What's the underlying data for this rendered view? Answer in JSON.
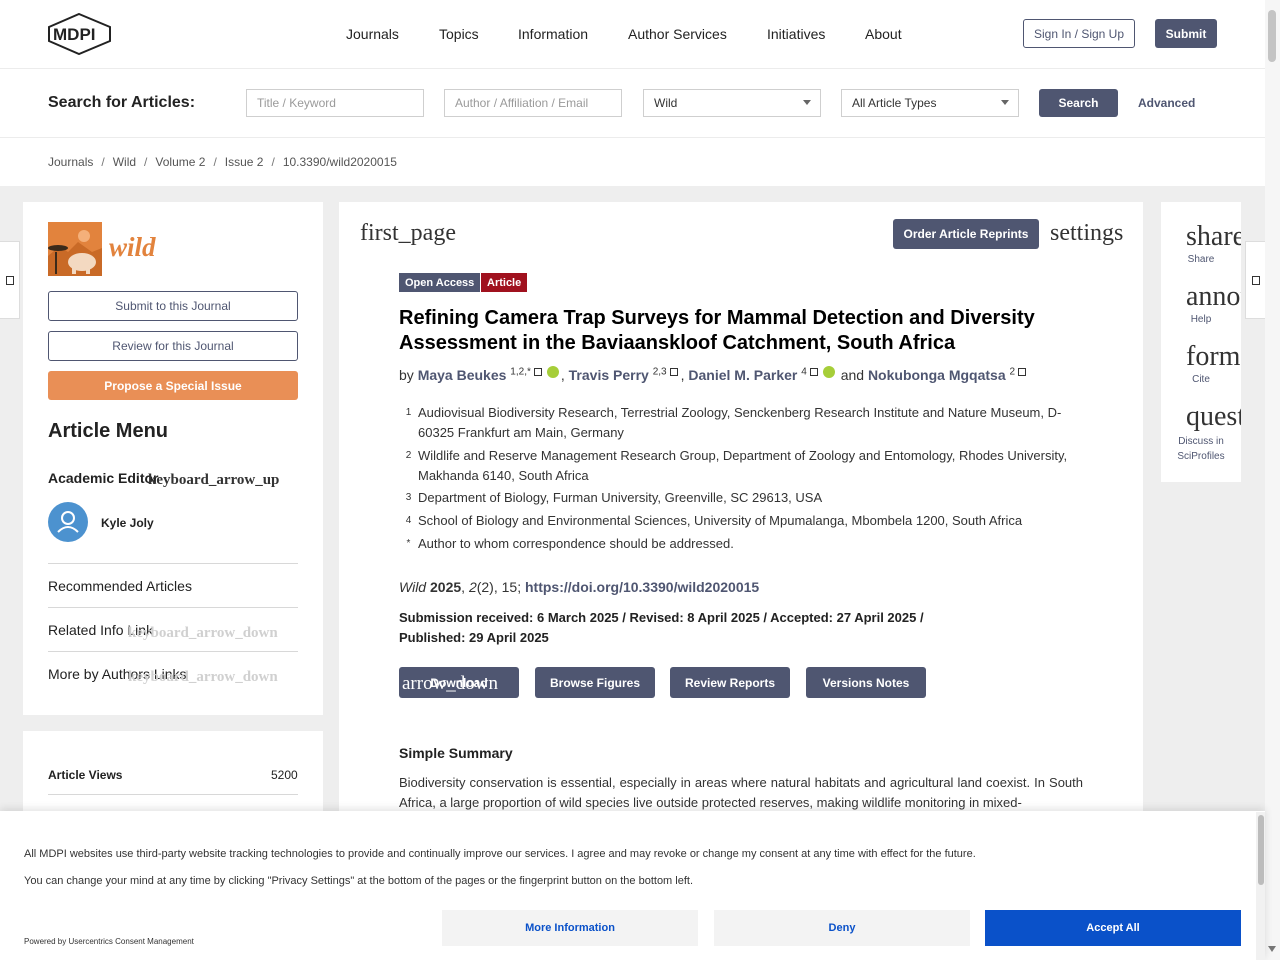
{
  "header": {
    "logo_text": "MDPI",
    "nav": [
      "Journals",
      "Topics",
      "Information",
      "Author Services",
      "Initiatives",
      "About"
    ],
    "signin": "Sign In / Sign Up",
    "submit": "Submit"
  },
  "search": {
    "label": "Search for Articles:",
    "title_placeholder": "Title / Keyword",
    "author_placeholder": "Author / Affiliation / Email",
    "journal": "Wild",
    "type": "All Article Types",
    "button": "Search",
    "advanced": "Advanced"
  },
  "breadcrumb": [
    "Journals",
    "Wild",
    "Volume 2",
    "Issue 2",
    "10.3390/wild2020015"
  ],
  "sidebar": {
    "journal_name": "wild",
    "submit": "Submit to this Journal",
    "review": "Review for this Journal",
    "propose": "Propose a Special Issue",
    "menu_title": "Article Menu",
    "academic_editor": "Academic Editor",
    "arrow_up": "keyboard_arrow_up",
    "editor_name": "Kyle Joly",
    "links": [
      "Recommended Articles",
      "Related Info Link",
      "More by Authors Links"
    ],
    "arrow_down": "keyboard_arrow_down",
    "views_label": "Article Views",
    "views_value": "5200"
  },
  "article": {
    "first_page": "first_page",
    "order_reprints": "Order Article Reprints",
    "settings": "settings",
    "tag_open": "Open Access",
    "tag_type": "Article",
    "title": "Refining Camera Trap Surveys for Mammal Detection and Diversity Assessment in the Baviaanskloof Catchment, South Africa",
    "by": "by",
    "authors": [
      {
        "name": "Maya Beukes",
        "sup": "1,2,*"
      },
      {
        "name": "Travis Perry",
        "sup": "2,3"
      },
      {
        "name": "Daniel M. Parker",
        "sup": "4"
      },
      {
        "name": "Nokubonga Mgqatsa",
        "sup": "2"
      }
    ],
    "and": "and",
    "affiliations": [
      {
        "n": "1",
        "t": "Audiovisual Biodiversity Research, Terrestrial Zoology, Senckenberg Research Institute and Nature Museum, D-60325 Frankfurt am Main, Germany"
      },
      {
        "n": "2",
        "t": "Wildlife and Reserve Management Research Group, Department of Zoology and Entomology, Rhodes University, Makhanda 6140, South Africa"
      },
      {
        "n": "3",
        "t": "Department of Biology, Furman University, Greenville, SC 29613, USA"
      },
      {
        "n": "4",
        "t": "School of Biology and Environmental Sciences, University of Mpumalanga, Mbombela 1200, South Africa"
      },
      {
        "n": "*",
        "t": "Author to whom correspondence should be addressed."
      }
    ],
    "cite_journal": "Wild",
    "cite_year": "2025",
    "cite_vol": "2",
    "cite_rest": "(2), 15;",
    "doi": "https://doi.org/10.3390/wild2020015",
    "dates": "Submission received: 6 March 2025 / Revised: 8 April 2025 / Accepted: 27 April 2025 / Published: 29 April 2025",
    "actions": [
      "Download",
      "Browse Figures",
      "Review Reports",
      "Versions Notes"
    ],
    "download_overlay": "arrow_down",
    "summary_heading": "Simple Summary",
    "summary": "Biodiversity conservation is essential, especially in areas where natural habitats and agricultural land coexist. In South Africa, a large proportion of wild species live outside protected reserves, making wildlife monitoring in mixed-"
  },
  "right_tools": [
    {
      "icon": "share",
      "label": "Share"
    },
    {
      "icon": "announcement",
      "label": "Help"
    },
    {
      "icon": "format_quote",
      "label": "Cite"
    },
    {
      "icon": "question_answer",
      "label": "Discuss in SciProfiles"
    }
  ],
  "consent": {
    "line1": "All MDPI websites use third-party website tracking technologies to provide and continually improve our services. I agree and may revoke or change my consent at any time with effect for the future.",
    "line2": "You can change your mind at any time by clicking \"Privacy Settings\" at the bottom of the pages or the fingerprint button on the bottom left.",
    "powered": "Powered by Usercentrics Consent Management",
    "more": "More Information",
    "deny": "Deny",
    "accept": "Accept All"
  },
  "colors": {
    "brand": "#4f5671",
    "accent": "#e98f56",
    "tag_red": "#a0111e",
    "accept": "#0a51c9"
  }
}
